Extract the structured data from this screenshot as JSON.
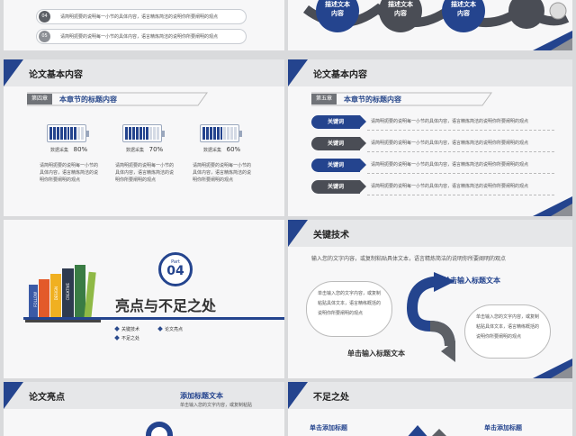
{
  "common": {
    "placeholder_short": "请简明扼要的说明每一小节的具体内容，语言精炼简洁的说明你所要阐明的观点",
    "placeholder_wrap": "请简明扼要的说明每一小节的具体内容，语言精炼简洁的说明你所要阐明的观点",
    "accent": "#24448e",
    "gray": "#5d6066"
  },
  "slide1": {
    "items": [
      {
        "num": "04",
        "text": "请简明扼要的说明每一小节的具体内容，语言精炼简洁的说明你所要阐明的观点"
      },
      {
        "num": "05",
        "text": "请简明扼要的说明每一小节的具体内容，语言精炼简洁的说明你所要阐明的观点"
      }
    ]
  },
  "slide2": {
    "circles": [
      "描述文本内容",
      "描述文本内容",
      "描述文本内容"
    ]
  },
  "slide3": {
    "title": "论文基本内容",
    "chapter_tag": "第四章",
    "chapter_title": "本章节的标题内容",
    "batteries": [
      {
        "label": "数据采集",
        "value": "80%",
        "level": 0.8,
        "desc": "请简明扼要的说明每一小节的具体内容，语言精炼简洁的说明你所要阐明的观点"
      },
      {
        "label": "数据采集",
        "value": "70%",
        "level": 0.7,
        "desc": "请简明扼要的说明每一小节的具体内容，语言精炼简洁的说明你所要阐明的观点"
      },
      {
        "label": "数据采集",
        "value": "60%",
        "level": 0.6,
        "desc": "请简明扼要的说明每一小节的具体内容，语言精炼简洁的说明你所要阐明的观点"
      }
    ]
  },
  "slide4": {
    "title": "论文基本内容",
    "chapter_tag": "第五章",
    "chapter_title": "本章节的标题内容",
    "keywords": [
      {
        "label": "关键词",
        "text": "请简明扼要的说明每一小节的具体内容，语言精炼简洁的说明你所要阐明的观点",
        "color": "#24448e"
      },
      {
        "label": "关键词",
        "text": "请简明扼要的说明每一小节的具体内容，语言精炼简洁的说明你所要阐明的观点",
        "color": "#4a4d55"
      },
      {
        "label": "关键词",
        "text": "请简明扼要的说明每一小节的具体内容，语言精炼简洁的说明你所要阐明的观点",
        "color": "#24448e"
      },
      {
        "label": "关键词",
        "text": "请简明扼要的说明每一小节的具体内容，语言精炼简洁的说明你所要阐明的观点",
        "color": "#4a4d55"
      }
    ]
  },
  "slide5": {
    "part_label": "Part",
    "part_num": "04",
    "title": "亮点与不足之处",
    "bullets": [
      "关键技术",
      "论文亮点",
      "不足之处"
    ],
    "book_texts": [
      "FOLLOW",
      "DESIGN",
      "CREATIVE"
    ]
  },
  "slide6": {
    "title": "关键技术",
    "intro": "输入您的文字内容，或复制粘贴具体文本，语言精炼简洁的说明你所要阐明的观点",
    "heading_top": "单击输入标题文本",
    "heading_bottom": "单击输入标题文本",
    "bubble_left": "单击输入您的文字内容，或复制粘贴具体文本，语言精练概括的说明你所要阐明的观点",
    "bubble_right": "单击输入您的文字内容，或复制粘贴具体文本，语言精练概括的说明你所要阐明的观点"
  },
  "slide7": {
    "title": "论文亮点",
    "heading": "添加标题文本",
    "subtext": "单击输入您的文字内容，或复制粘贴"
  },
  "slide8": {
    "title": "不足之处",
    "heading_left": "单击添加标题",
    "heading_right": "单击添加标题"
  }
}
